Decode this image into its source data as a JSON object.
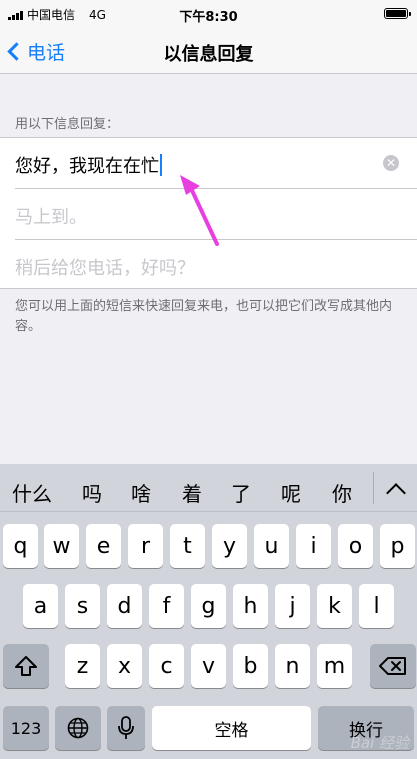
{
  "status_bar": {
    "carrier": "中国电信",
    "network": "4G",
    "time": "下午8:30"
  },
  "nav": {
    "back_label": "电话",
    "title": "以信息回复"
  },
  "section_header": "用以下信息回复：",
  "replies": [
    {
      "text": "您好，我现在在忙",
      "editing": true
    },
    {
      "text": "马上到。",
      "placeholder": true
    },
    {
      "text": "稍后给您电话，好吗？",
      "placeholder": true
    }
  ],
  "footer_note": "您可以用上面的短信来快速回复来电，也可以把它们改写成其他内容。",
  "annotation": {
    "arrow_color": "#e83fe0"
  },
  "keyboard": {
    "candidates": [
      "什么",
      "吗",
      "啥",
      "着",
      "了",
      "呢",
      "你"
    ],
    "row1": [
      "q",
      "w",
      "e",
      "r",
      "t",
      "y",
      "u",
      "i",
      "o",
      "p"
    ],
    "row2": [
      "a",
      "s",
      "d",
      "f",
      "g",
      "h",
      "j",
      "k",
      "l"
    ],
    "row3": [
      "z",
      "x",
      "c",
      "v",
      "b",
      "n",
      "m"
    ],
    "numbers_key": "123",
    "space_key": "空格",
    "return_key": "换行"
  },
  "colors": {
    "accent": "#157efb",
    "background": "#efeff4",
    "keyboard_bg": "#d1d4da"
  },
  "watermark": "Bai 经验"
}
